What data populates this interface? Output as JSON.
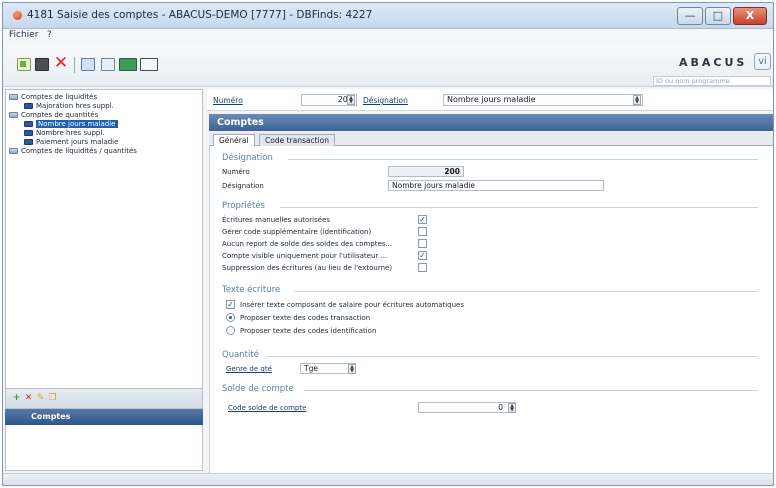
{
  "window": {
    "title": "4181 Saisie des comptes - ABACUS-DEMO [7777] - DBFinds: 4227",
    "minimize": "—",
    "maximize": "□",
    "close": "X"
  },
  "menu": {
    "items": [
      "Fichier",
      "?"
    ]
  },
  "logo": {
    "text": "ABACUS",
    "badge": "vi"
  },
  "program_search": {
    "placeholder": "ID ou nom programme"
  },
  "tree": {
    "items": [
      {
        "label": "Comptes de liquidités",
        "level": 0
      },
      {
        "label": "Majoration hres suppl.",
        "level": 1
      },
      {
        "label": "Comptes de quantités",
        "level": 0
      },
      {
        "label": "Nombre jours maladie",
        "level": 1,
        "selected": true
      },
      {
        "label": "Nombre hres suppl.",
        "level": 1
      },
      {
        "label": "Paiement jours maladie",
        "level": 1
      },
      {
        "label": "Comptes de liquidités / quantités",
        "level": 0
      }
    ]
  },
  "sidebar_actions": {
    "add": "+",
    "delete": "✕",
    "edit": "✎",
    "copy": "❐"
  },
  "side_panel": {
    "tab_label": "Comptes"
  },
  "header": {
    "numero_label": "Numéro",
    "numero_value": "200",
    "designation_label": "Désignation",
    "designation_value": "Nombre jours maladie"
  },
  "panel": {
    "title": "Comptes"
  },
  "tabs": [
    {
      "label": "Général",
      "active": true
    },
    {
      "label": "Code transaction",
      "active": false
    }
  ],
  "sections": {
    "designation": {
      "title": "Désignation",
      "numero_label": "Numéro",
      "numero_value": "200",
      "designation_label": "Désignation",
      "designation_value": "Nombre jours maladie"
    },
    "proprietes": {
      "title": "Propriétés",
      "items": [
        {
          "label": "Écritures manuelles autorisées",
          "checked": true
        },
        {
          "label": "Gérer code supplémentaire (identification)",
          "checked": false
        },
        {
          "label": "Aucun report de solde des soldes des comptes...",
          "checked": false
        },
        {
          "label": "Compte visible uniquement pour l'utilisateur ...",
          "checked": true
        },
        {
          "label": "Suppression des écritures (au lieu de l'extourne)",
          "checked": false
        }
      ]
    },
    "texte_ecriture": {
      "title": "Texte écriture",
      "insert_label": "Insérer texte composant de salaire pour écritures automatiques",
      "insert_checked": true,
      "radio_transaction": "Proposer texte des codes transaction",
      "radio_identification": "Proposer texte des codes identification",
      "radio_selected": "transaction"
    },
    "quantite": {
      "title": "Quantité",
      "genre_label": "Genre de qté",
      "genre_value": "Tge"
    },
    "solde": {
      "title": "Solde de compte",
      "code_label": "Code solde de compte",
      "code_value": "0"
    }
  }
}
